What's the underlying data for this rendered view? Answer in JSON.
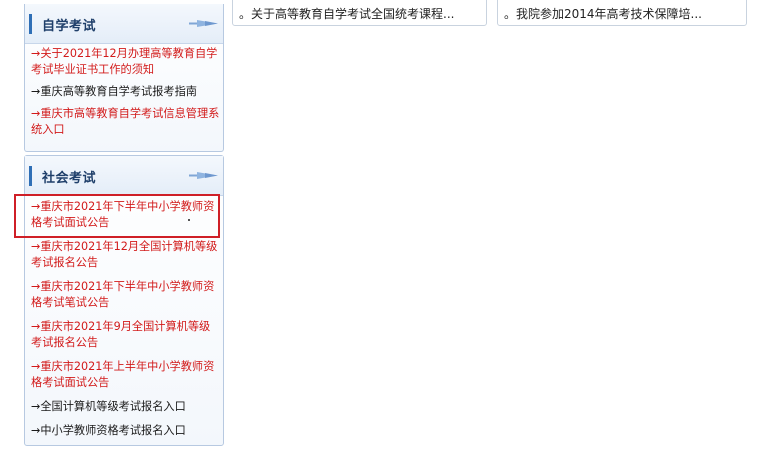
{
  "self_exam": {
    "title": "自学考试",
    "items": [
      {
        "label": "→关于2021年12月办理高等教育自学考试毕业证书工作的须知",
        "color": "#d21a1a"
      },
      {
        "label": "→重庆高等教育自学考试报考指南",
        "color": "#1a1a1a"
      },
      {
        "label": "→重庆市高等教育自学考试信息管理系统入口",
        "color": "#d21a1a"
      }
    ]
  },
  "social_exam": {
    "title": "社会考试",
    "items": [
      {
        "label": "→重庆市2021年下半年中小学教师资格考试面试公告",
        "color": "#d21a1a"
      },
      {
        "label": "→重庆市2021年12月全国计算机等级考试报名公告",
        "color": "#d21a1a"
      },
      {
        "label": "→重庆市2021年下半年中小学教师资格考试笔试公告",
        "color": "#d21a1a"
      },
      {
        "label": "→重庆市2021年9月全国计算机等级考试报名公告",
        "color": "#d21a1a"
      },
      {
        "label": "→重庆市2021年上半年中小学教师资格考试面试公告",
        "color": "#d21a1a"
      },
      {
        "label": "→全国计算机等级考试报名入口",
        "color": "#1a1a1a"
      },
      {
        "label": "→中小学教师资格考试报名入口",
        "color": "#1a1a1a"
      }
    ]
  },
  "news": [
    {
      "label": "。关于高等教育自学考试全国统考课程..."
    },
    {
      "label": "。我院参加2014年高考技术保障培..."
    }
  ],
  "colors": {
    "accent": "#2f6fb6",
    "highlight_red": "#cf1f27",
    "link_red": "#d21a1a"
  }
}
